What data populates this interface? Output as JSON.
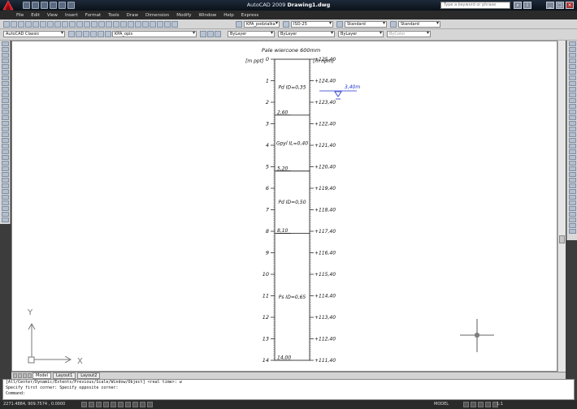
{
  "title_bar": {
    "app": "AutoCAD 2009",
    "document": "Drawing1.dwg",
    "search_placeholder": "Type a keyword or phrase"
  },
  "menu": [
    "File",
    "Edit",
    "View",
    "Insert",
    "Format",
    "Tools",
    "Draw",
    "Dimension",
    "Modify",
    "Window",
    "Help",
    "Express"
  ],
  "toolbars": {
    "text_style": "KPA_podzialka",
    "dim_style": "ISO-25",
    "table_style": "Standard",
    "multileader_style": "Standard",
    "workspace": "AutoCAD Classic",
    "layer": "KPA_opis",
    "color": "ByLayer",
    "linetype": "ByLayer",
    "lineweight": "ByLayer",
    "plot_style": "ByColor"
  },
  "drawing": {
    "title": "Pale wiercone 600mm",
    "left_header": "[m ppt]",
    "right_header": "[m npm]",
    "water_level": "3,40m",
    "depths": [
      "0",
      "1",
      "2",
      "3",
      "4",
      "5",
      "6",
      "7",
      "8",
      "9",
      "10",
      "11",
      "12",
      "13",
      "14"
    ],
    "elevations": [
      "+125,40",
      "+124,40",
      "+123,40",
      "+122,40",
      "+121,40",
      "+120,40",
      "+119,40",
      "+118,40",
      "+117,40",
      "+116,40",
      "+115,40",
      "+114,40",
      "+113,40",
      "+112,40",
      "+111,40"
    ],
    "layers": [
      {
        "label": "Pd ID=0,35",
        "bottom": "2,60",
        "top_depth": 0,
        "bottom_depth": 2.6
      },
      {
        "label": "Gpyl IL=0,40",
        "bottom": "5,20",
        "top_depth": 2.6,
        "bottom_depth": 5.2
      },
      {
        "label": "Pd ID=0,50",
        "bottom": "8,10",
        "top_depth": 5.2,
        "bottom_depth": 8.1
      },
      {
        "label": "Ps ID=0,65",
        "bottom": "14,00",
        "top_depth": 8.1,
        "bottom_depth": 14.0
      }
    ],
    "ucs": {
      "x": "X",
      "y": "Y"
    }
  },
  "tabs": [
    "Model",
    "Layout1",
    "Layout2"
  ],
  "command_line": {
    "line1": "[All/Center/Dynamic/Extents/Previous/Scale/Window/Object] <real time>: w",
    "line2": "Specify first corner: Specify opposite corner:",
    "prompt": "Command:"
  },
  "status": {
    "coords": "2271.4884, 909.7574 , 0.0000",
    "model": "MODEL",
    "scale": "1:1"
  }
}
